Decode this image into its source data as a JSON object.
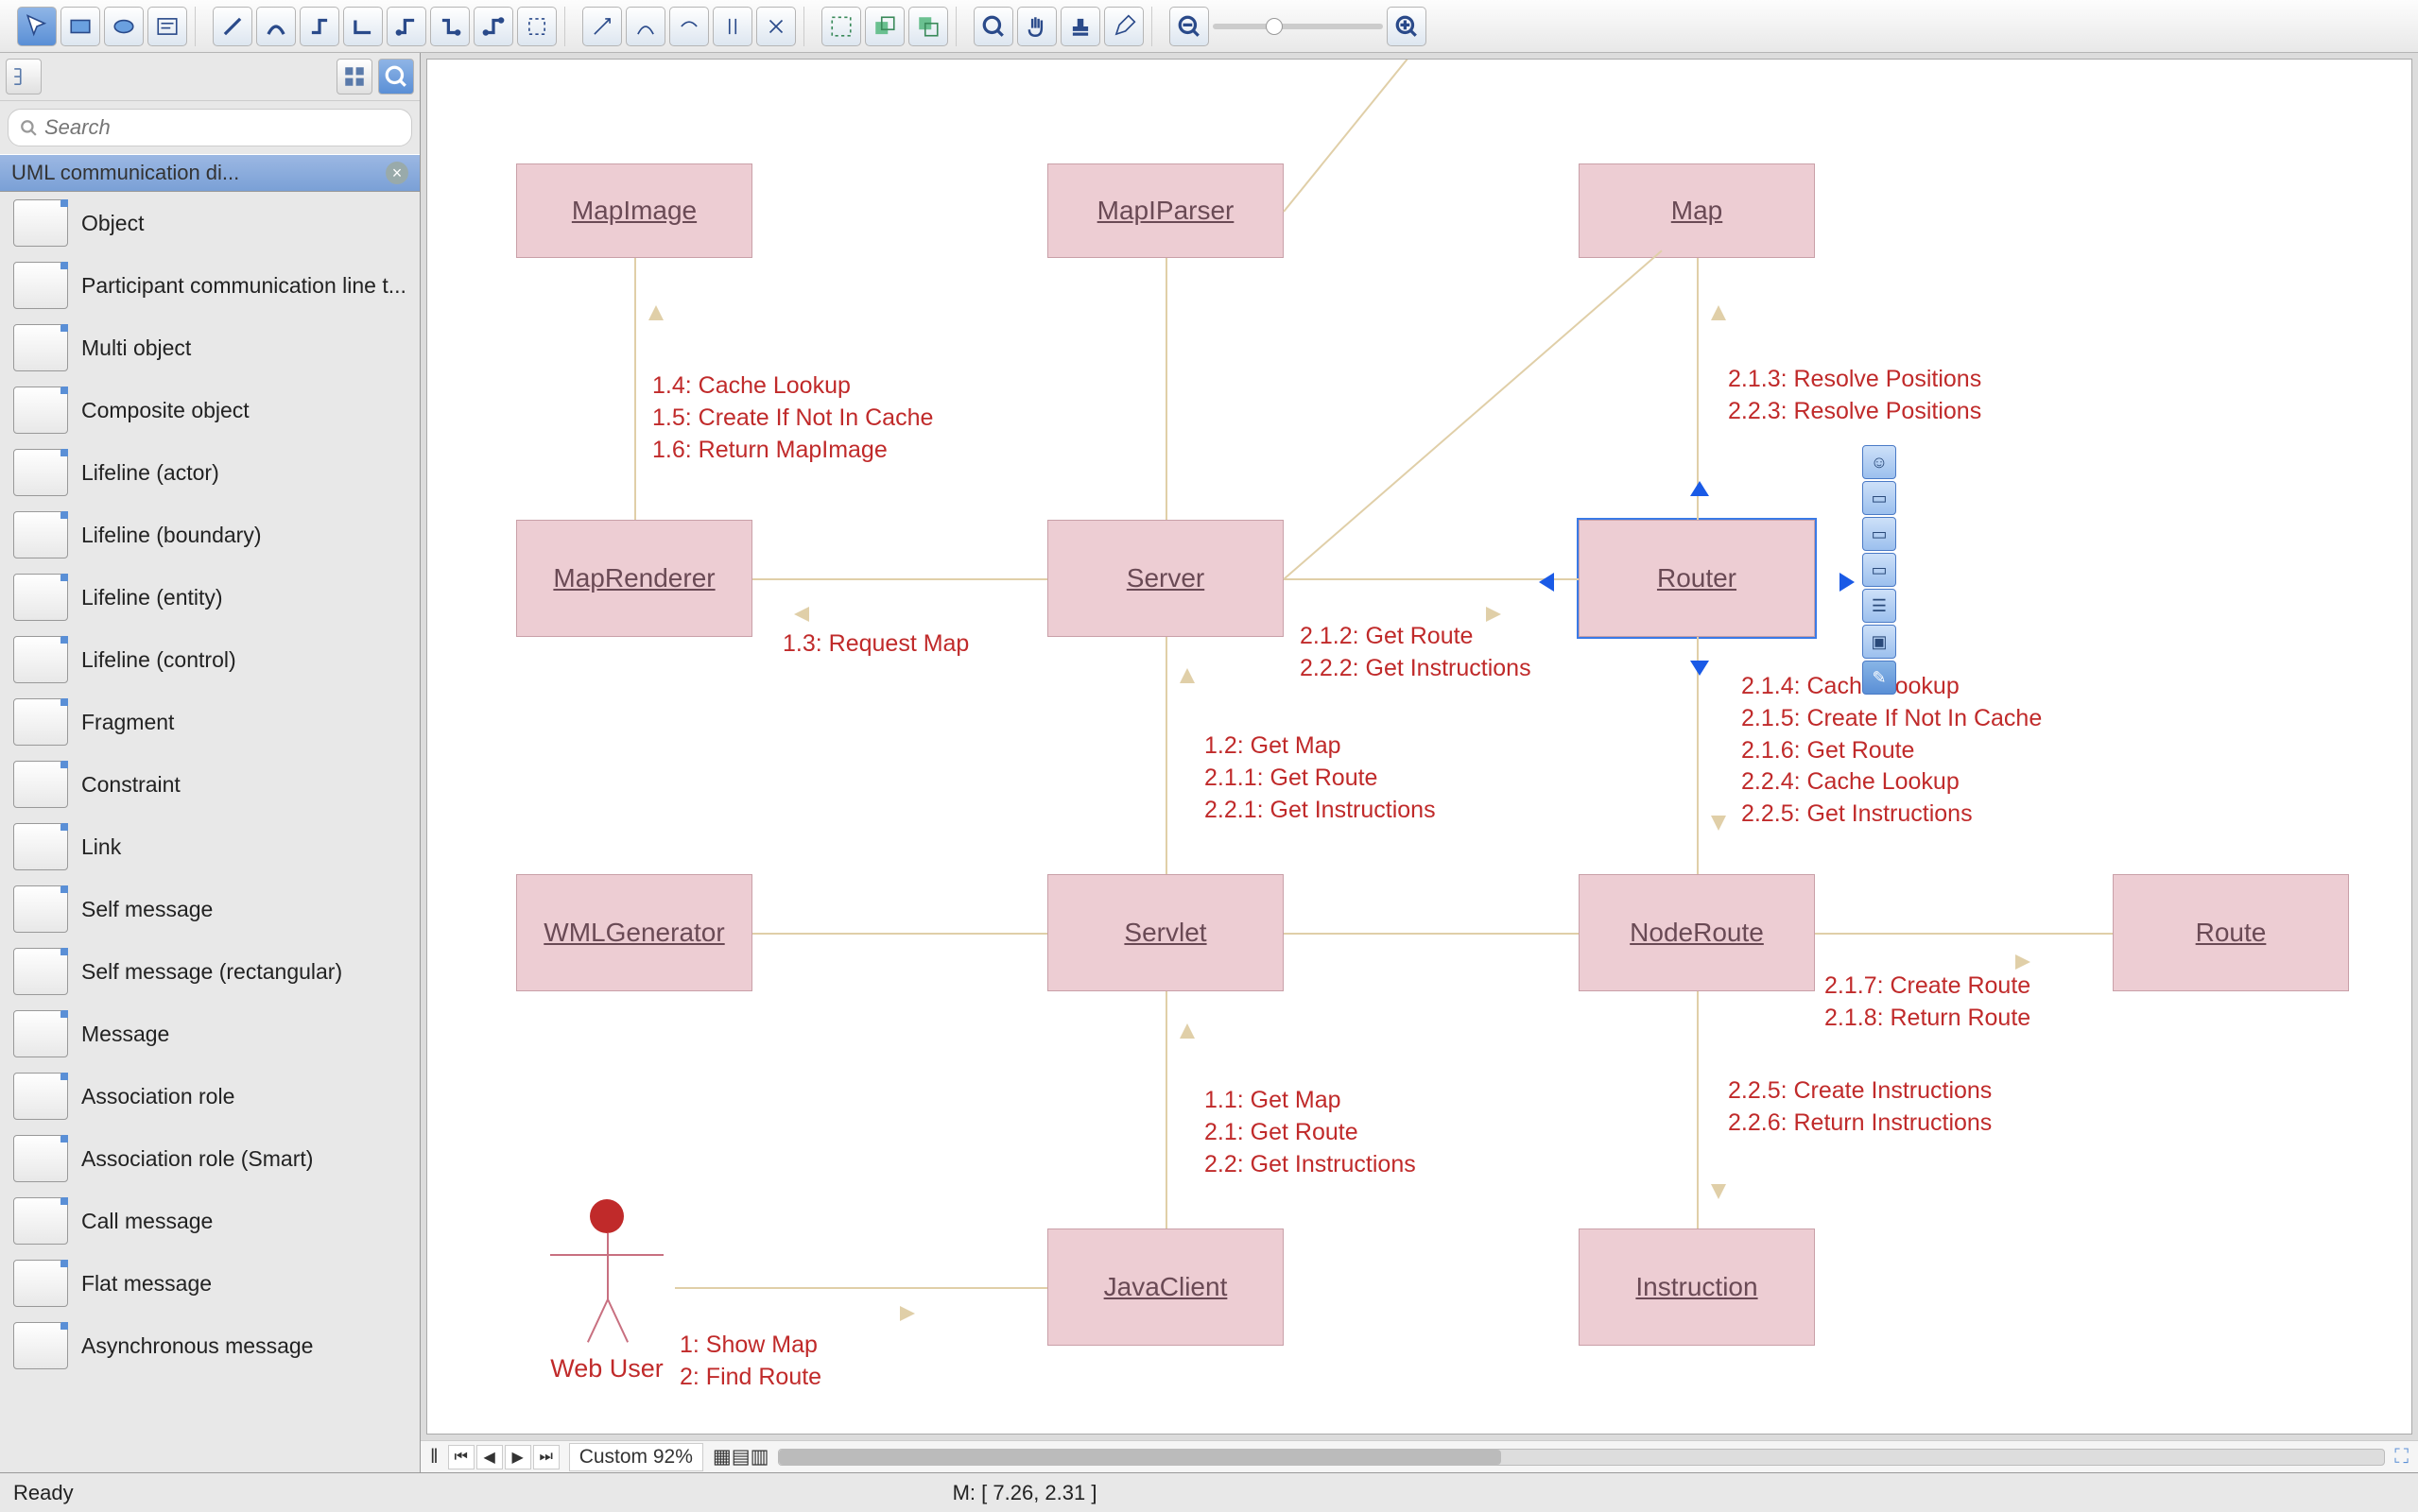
{
  "toolbar": {
    "zoom_out": "−",
    "zoom_in": "+"
  },
  "sidebar": {
    "search_placeholder": "Search",
    "title": "UML communication di...",
    "items": [
      {
        "label": "Object"
      },
      {
        "label": "Participant communication line t..."
      },
      {
        "label": "Multi object"
      },
      {
        "label": "Composite object"
      },
      {
        "label": "Lifeline (actor)"
      },
      {
        "label": "Lifeline (boundary)"
      },
      {
        "label": "Lifeline (entity)"
      },
      {
        "label": "Lifeline (control)"
      },
      {
        "label": "Fragment"
      },
      {
        "label": "Constraint"
      },
      {
        "label": "Link"
      },
      {
        "label": "Self message"
      },
      {
        "label": "Self message (rectangular)"
      },
      {
        "label": "Message"
      },
      {
        "label": "Association role"
      },
      {
        "label": "Association role (Smart)"
      },
      {
        "label": "Call message"
      },
      {
        "label": "Flat message"
      },
      {
        "label": "Asynchronous message"
      }
    ]
  },
  "diagram": {
    "nodes": {
      "mapimage": "MapImage",
      "mapiparser": "MapIParser",
      "map": "Map",
      "maprenderer": "MapRenderer",
      "server": "Server",
      "router": "Router",
      "wmlgenerator": "WMLGenerator",
      "servlet": "Servlet",
      "noderoute": "NodeRoute",
      "route": "Route",
      "javaclient": "JavaClient",
      "instruction": "Instruction"
    },
    "actor": "Web User",
    "messages": {
      "m1": "1.4: Cache Lookup\n1.5: Create If Not In Cache\n1.6: Return MapImage",
      "m2": "1.3: Request Map",
      "m3": "2.1.2: Get Route\n2.2.2: Get Instructions",
      "m4": "2.1.3: Resolve Positions\n2.2.3: Resolve Positions",
      "m5": "1.2: Get Map\n2.1.1: Get Route\n2.2.1: Get Instructions",
      "m6": "2.1.4: Cache Lookup\n2.1.5: Create If Not In Cache\n2.1.6: Get Route\n2.2.4: Cache Lookup\n2.2.5: Get Instructions",
      "m7": "2.1.7: Create Route\n2.1.8: Return Route",
      "m8": "1.1: Get Map\n2.1: Get Route\n2.2: Get Instructions",
      "m9": "2.2.5: Create Instructions\n2.2.6: Return Instructions",
      "m10": "1: Show Map\n2: Find Route"
    }
  },
  "scrollbar": {
    "zoom": "Custom 92%"
  },
  "status": {
    "ready": "Ready",
    "coords": "M: [ 7.26, 2.31 ]"
  }
}
